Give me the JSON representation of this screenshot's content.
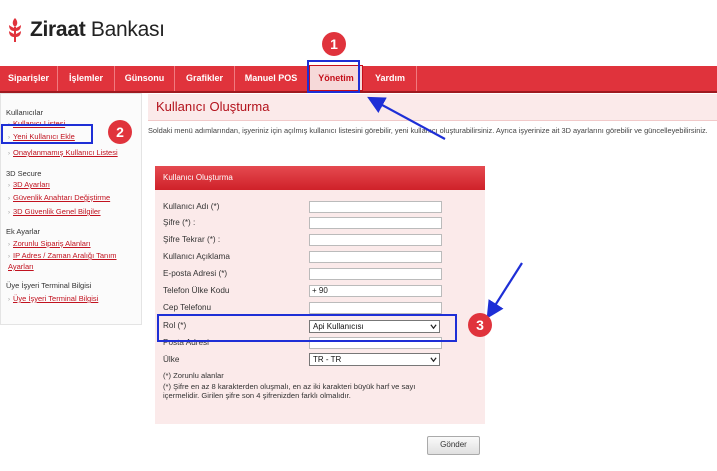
{
  "brand": {
    "name_bold": "Ziraat",
    "name_rest": " Bankası"
  },
  "nav": [
    {
      "label": "Siparişler"
    },
    {
      "label": "İşlemler"
    },
    {
      "label": "Günsonu"
    },
    {
      "label": "Grafikler"
    },
    {
      "label": "Manuel POS"
    },
    {
      "label": "Yönetim",
      "active": true
    },
    {
      "label": "Yardım"
    }
  ],
  "sidebar": {
    "sections": [
      {
        "title": "Kullanıcılar",
        "items": [
          "Kullanıcı Listesi",
          "Yeni Kullanıcı Ekle",
          "Onaylanmamış Kullanıcı Listesi"
        ]
      },
      {
        "title": "3D Secure",
        "items": [
          "3D Ayarları",
          "Güvenlik Anahtarı Değiştirme",
          "3D Güvenlik Genel Bilgiler"
        ]
      },
      {
        "title": "Ek Ayarlar",
        "items": [
          "Zorunlu Sipariş Alanları",
          "IP Adres / Zaman Aralığı Tanım Ayarları"
        ]
      },
      {
        "title": "Üye İşyeri Terminal Bilgisi",
        "items": [
          "Üye İşyeri Terminal Bilgisi"
        ]
      }
    ]
  },
  "page": {
    "title": "Kullanıcı Oluşturma",
    "info": "Soldaki menü adımlarından, işyeriniz için açılmış kullanıcı listesini görebilir, yeni kullanıcı oluşturabilirsiniz. Ayrıca işyerinize ait 3D ayarlarını görebilir ve güncelleyebilirsiniz."
  },
  "form": {
    "header": "Kullanıcı Oluşturma",
    "fields": {
      "username": {
        "label": "Kullanıcı Adı (*)",
        "value": ""
      },
      "password": {
        "label": "Şifre (*) :",
        "value": ""
      },
      "password_repeat": {
        "label": "Şifre Tekrar (*) :",
        "value": ""
      },
      "description": {
        "label": "Kullanıcı Açıklama",
        "value": ""
      },
      "email": {
        "label": "E-posta Adresi (*)",
        "value": ""
      },
      "country_code": {
        "label": "Telefon Ülke Kodu",
        "value": "+ 90"
      },
      "mobile": {
        "label": "Cep Telefonu",
        "value": ""
      },
      "role": {
        "label": "Rol (*)",
        "value": "Api Kullanıcısı"
      },
      "postal": {
        "label": "Posta Adresi",
        "value": ""
      },
      "country": {
        "label": "Ülke",
        "value": "TR - TR"
      }
    },
    "required_note": "(*) Zorunlu alanlar",
    "password_note_1": "(*) Şifre en az 8 karakterden oluşmalı, en az iki karakteri büyük harf ve sayı",
    "password_note_2": "içermelidir. Girilen şifre son 4 şifrenizden farklı olmalıdır.",
    "submit_label": "Gönder"
  },
  "annotations": {
    "badge_1": "1",
    "badge_2": "2",
    "badge_3": "3",
    "color": "#1e2fd6",
    "badge_color": "#e0333c"
  }
}
